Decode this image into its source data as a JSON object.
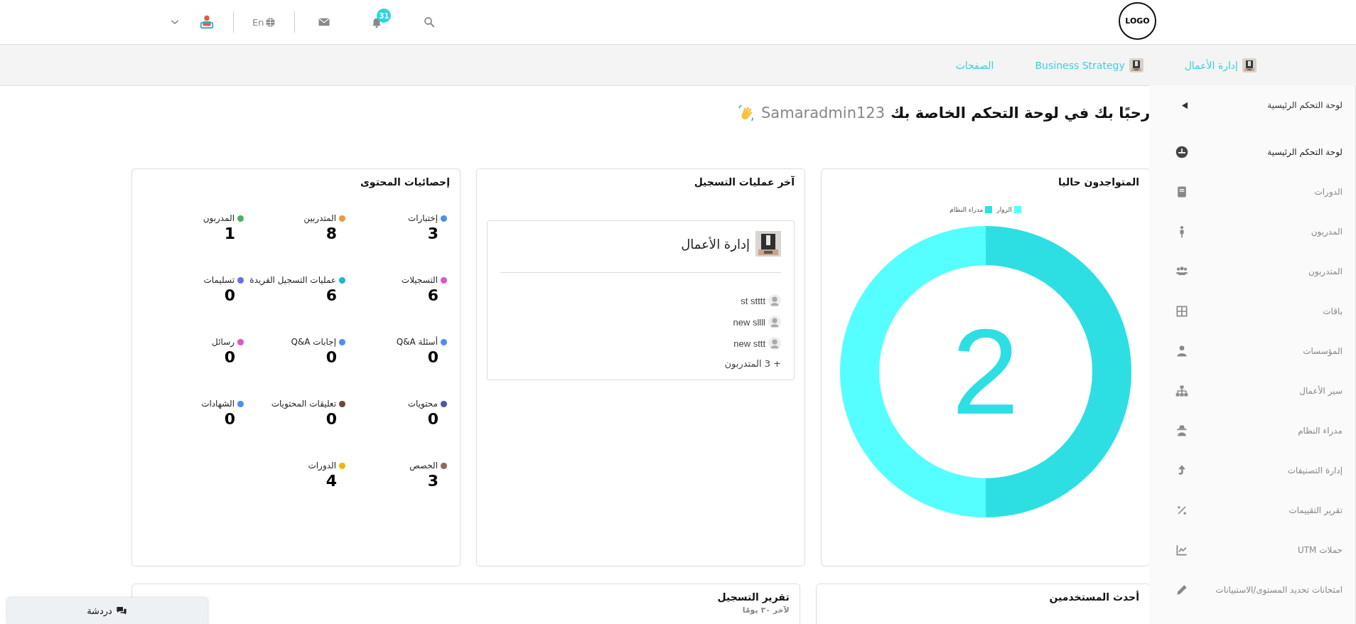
{
  "header": {
    "logo": "LOGO",
    "notifications": "31",
    "language": "En"
  },
  "breadcrumbs": [
    {
      "label": "إدارة الأعمال",
      "thumb": true
    },
    {
      "label": "Business Strategy",
      "thumb": true
    },
    {
      "label": "الصفحات",
      "thumb": false
    }
  ],
  "welcome": {
    "text": "رحبًا بك في لوحة التحكم الخاصة بك",
    "username": "Samaradmin123"
  },
  "online_card": {
    "title": "المتواجدون حاليا",
    "total": "2",
    "chart_data": {
      "type": "donut",
      "categories": [
        "الزوار",
        "مدراء النظام"
      ],
      "values": [
        50,
        50
      ],
      "colors": [
        "#55ffff",
        "#2ddfe3"
      ]
    }
  },
  "registrations_card": {
    "title": "آخر عمليات التسجيل",
    "course": "إدارة الأعمال",
    "students": [
      "st stttt",
      "new sllll",
      "new sttt"
    ],
    "more": "+ 3 المتدربون"
  },
  "stats_card": {
    "title": "إحصائيات المحتوى",
    "items": [
      {
        "label": "إختبارات",
        "value": "3",
        "color": "#4a8ff0"
      },
      {
        "label": "المتدربين",
        "value": "8",
        "color": "#ee9a3a"
      },
      {
        "label": "المدربون",
        "value": "1",
        "color": "#4caf63"
      },
      {
        "label": "التسجيلات",
        "value": "6",
        "color": "#e056c0"
      },
      {
        "label": "عمليات التسجيل الفريدة",
        "value": "6",
        "color": "#1ab8d6"
      },
      {
        "label": "تسليمات",
        "value": "0",
        "color": "#6a6ee6"
      },
      {
        "label": "أسئلة Q&A",
        "value": "0",
        "color": "#4a8ff0"
      },
      {
        "label": "إجابات Q&A",
        "value": "0",
        "color": "#4a8ff0"
      },
      {
        "label": "رسائل",
        "value": "0",
        "color": "#e056c0"
      },
      {
        "label": "محتويات",
        "value": "0",
        "color": "#4d55a8"
      },
      {
        "label": "تعليقات المحتويات",
        "value": "0",
        "color": "#6b4a3c"
      },
      {
        "label": "الشهادات",
        "value": "0",
        "color": "#4a8ff0"
      },
      {
        "label": "الحصص",
        "value": "3",
        "color": "#8a6a5a"
      },
      {
        "label": "الدورات",
        "value": "4",
        "color": "#f5b400"
      }
    ]
  },
  "bottom_cards": [
    {
      "title": "أحدث المستخدمين"
    },
    {
      "title": "تقرير التسجيل",
      "subtitle": "لآخر ٣٠ يومًا"
    }
  ],
  "chat_button": {
    "label": "دردشة"
  },
  "sidebar": {
    "header": "لوحة التحكم الرئيسية",
    "items": [
      {
        "label": "لوحة التحكم الرئيسية",
        "selected": true
      },
      {
        "label": "الدورات",
        "selected": false
      },
      {
        "label": "المدربون",
        "selected": false
      },
      {
        "label": "المتدربون",
        "selected": false
      },
      {
        "label": "باقات",
        "selected": false
      },
      {
        "label": "المؤسسات",
        "selected": false
      },
      {
        "label": "سير الأعمال",
        "selected": false
      },
      {
        "label": "مدراء النظام",
        "selected": false
      },
      {
        "label": "إدارة التصنيفات",
        "selected": false
      },
      {
        "label": "تقرير التقييمات",
        "selected": false
      },
      {
        "label": "حملات UTM",
        "selected": false
      },
      {
        "label": "امتحانات تحديد المستوى/الاستبيانات",
        "selected": false
      }
    ]
  }
}
